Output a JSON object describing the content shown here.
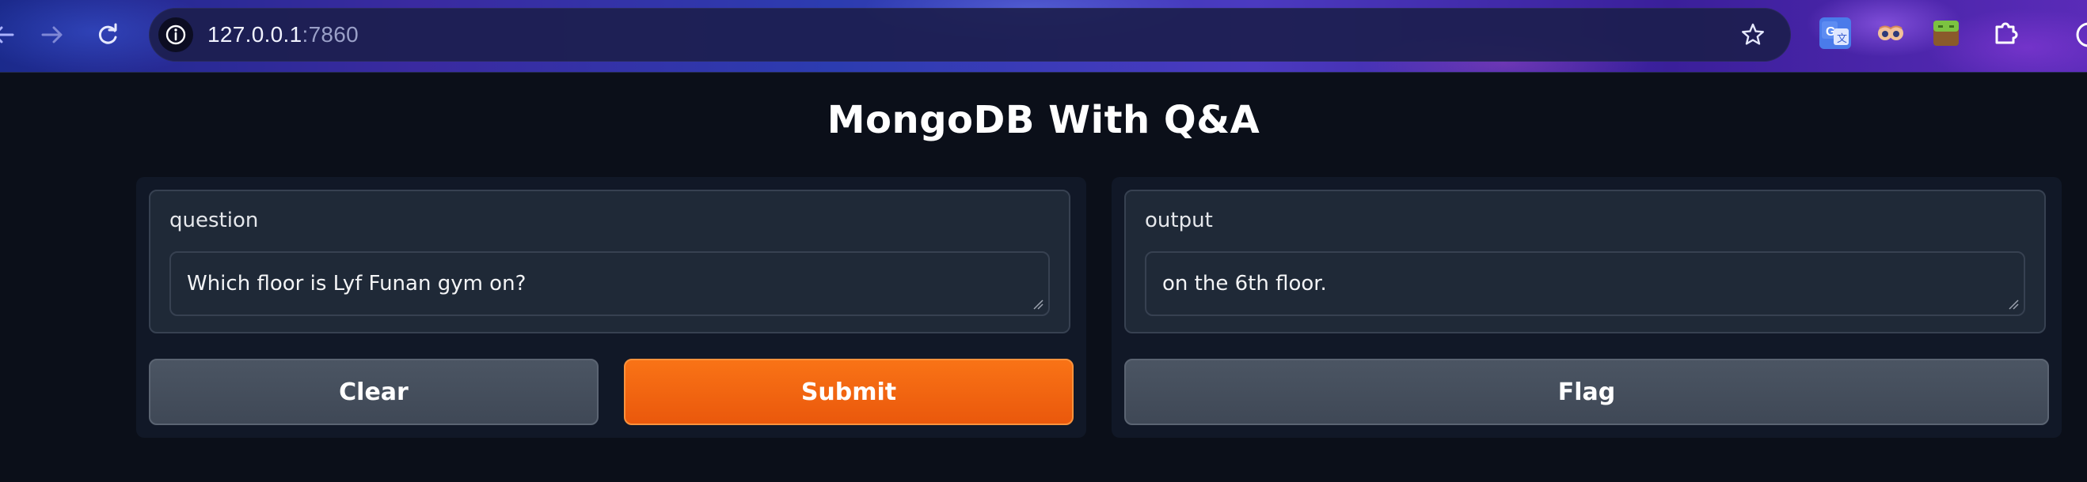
{
  "browser": {
    "url_host": "127.0.0.1",
    "url_port": ":7860",
    "icons": {
      "back": "back-arrow-icon",
      "forward": "forward-arrow-icon",
      "reload": "reload-icon",
      "site_info": "info-icon",
      "bookmark": "star-icon",
      "extensions": [
        "google-translate-icon",
        "eyes-extension-icon",
        "minecraft-block-icon",
        "puzzle-extensions-icon"
      ]
    }
  },
  "app": {
    "title": "MongoDB With Q&A",
    "input": {
      "label": "question",
      "value": "Which floor is Lyf Funan gym on?"
    },
    "output": {
      "label": "output",
      "value": "on the 6th floor."
    },
    "buttons": {
      "clear": "Clear",
      "submit": "Submit",
      "flag": "Flag"
    },
    "colors": {
      "background": "#0b0f19",
      "panel": "#111827",
      "primary": "#f97316",
      "secondary": "#4b5563"
    }
  }
}
